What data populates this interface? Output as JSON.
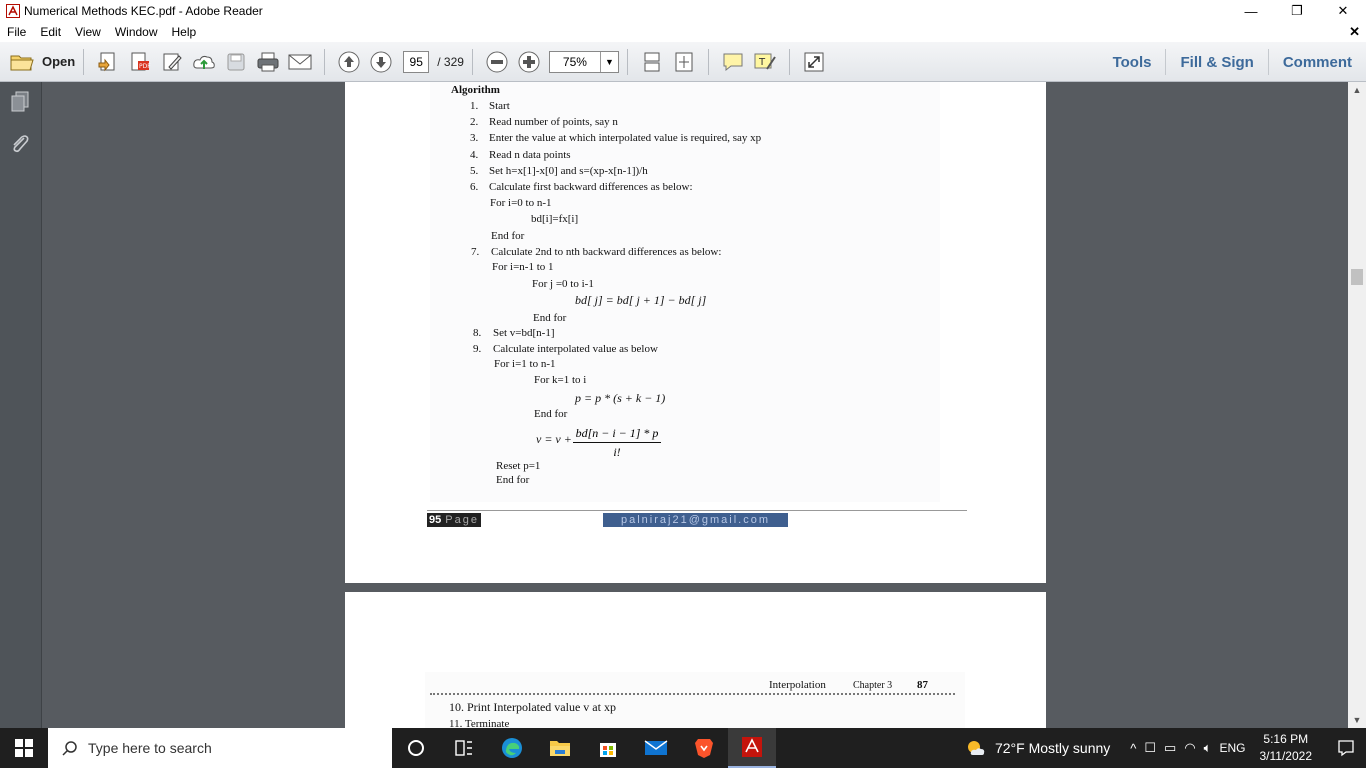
{
  "window": {
    "title": "Numerical Methods KEC.pdf - Adobe Reader",
    "minimize": "—",
    "restore": "❐",
    "close": "✕"
  },
  "menu": {
    "items": [
      "File",
      "Edit",
      "View",
      "Window",
      "Help"
    ],
    "close_doc": "✕"
  },
  "toolbar": {
    "open_label": "Open",
    "page_current": "95",
    "page_total": "/ 329",
    "zoom": "75%",
    "tools_label": "Tools",
    "fill_sign_label": "Fill & Sign",
    "comment_label": "Comment"
  },
  "document": {
    "heading": "Algorithm",
    "steps": [
      {
        "num": "1.",
        "text": "Start"
      },
      {
        "num": "2.",
        "text": "Read number of points, say n"
      },
      {
        "num": "3.",
        "text": "Enter the value at which interpolated value is required, say xp"
      },
      {
        "num": "4.",
        "text": "Read n data points"
      },
      {
        "num": "5.",
        "text": "Set h=x[1]-x[0]  and  s=(xp-x[n-1])/h"
      },
      {
        "num": "6.",
        "text": "Calculate first backward differences as below:"
      }
    ],
    "for1": "For i=0 to n-1",
    "bd_assign": "bd[i]=fx[i]",
    "endfor1": "End for",
    "step7_num": "7.",
    "step7": "Calculate 2nd to nth backward differences as below:",
    "for2": "For i=n-1 to 1",
    "for3": "For j =0 to i-1",
    "formula1": "bd[ j] = bd[ j + 1] − bd[ j]",
    "endfor3": "End for",
    "step8_num": "8.",
    "step8": "Set v=bd[n-1]",
    "step9_num": "9.",
    "step9": "Calculate interpolated value as below",
    "for4": "For i=1 to n-1",
    "for5": "For k=1 to i",
    "formula2": "p = p * (s + k − 1)",
    "endfor5": "End for",
    "v_lhs": "v = v +",
    "v_num": "bd[n − i − 1] * p",
    "v_den": "i!",
    "reset": "Reset p=1",
    "endfor4": "End for",
    "page_number": "95",
    "page_word": "Page",
    "email": "palniraj21@gmail.com",
    "next_header_title": "Interpolation",
    "next_header_chapter": "Chapter 3",
    "next_header_page": "87",
    "step10": "10.  Print Interpolated value v at xp",
    "step11": "11.  Terminate"
  },
  "taskbar": {
    "search_placeholder": "Type here to search",
    "weather": "72°F  Mostly sunny",
    "language": "ENG",
    "time": "5:16 PM",
    "date": "3/11/2022"
  }
}
